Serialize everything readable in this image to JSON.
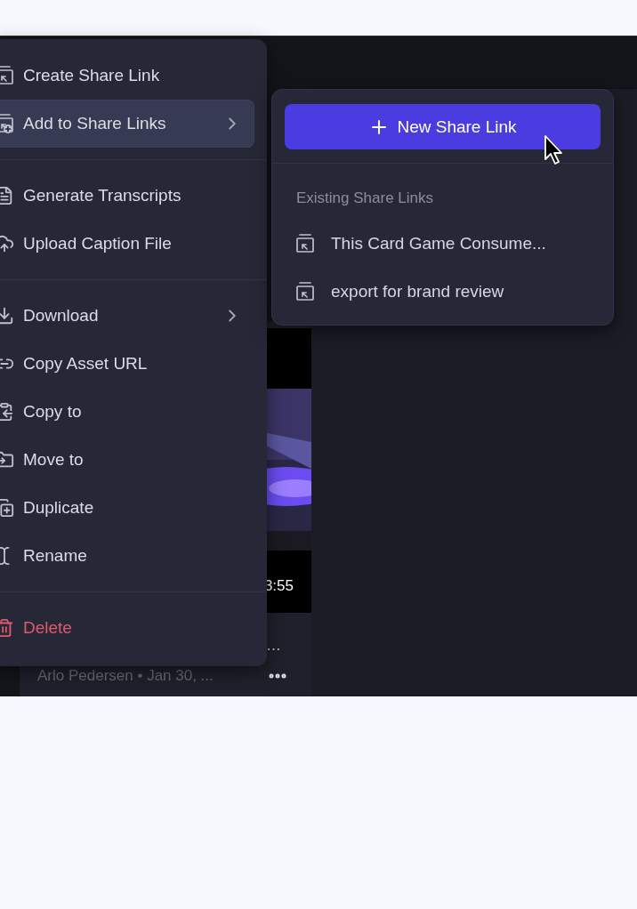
{
  "background_card": {
    "duration": "3:55",
    "title": "…",
    "meta": "Arlo Pedersen • Jan 30, ..."
  },
  "context_menu": {
    "items": [
      {
        "kind": "item",
        "label": "Create Share Link",
        "selected": false
      },
      {
        "kind": "submenu",
        "label": "Add to Share Links",
        "selected": true
      },
      {
        "kind": "separator"
      },
      {
        "kind": "item",
        "label": "Generate Transcripts",
        "selected": false
      },
      {
        "kind": "item",
        "label": "Upload Caption File",
        "selected": false
      },
      {
        "kind": "separator"
      },
      {
        "kind": "submenu",
        "label": "Download",
        "selected": false
      },
      {
        "kind": "item",
        "label": "Copy Asset URL",
        "selected": false
      },
      {
        "kind": "item",
        "label": "Copy to",
        "selected": false
      },
      {
        "kind": "item",
        "label": "Move to",
        "selected": false
      },
      {
        "kind": "item",
        "label": "Duplicate",
        "selected": false
      },
      {
        "kind": "item",
        "label": "Rename",
        "selected": false
      },
      {
        "kind": "separator"
      },
      {
        "kind": "danger",
        "label": "Delete",
        "selected": false
      }
    ]
  },
  "share_submenu": {
    "new_button": "New Share Link",
    "section_title": "Existing Share Links",
    "links": [
      {
        "label": "This Card Game Consume..."
      },
      {
        "label": "export for brand review"
      }
    ]
  }
}
